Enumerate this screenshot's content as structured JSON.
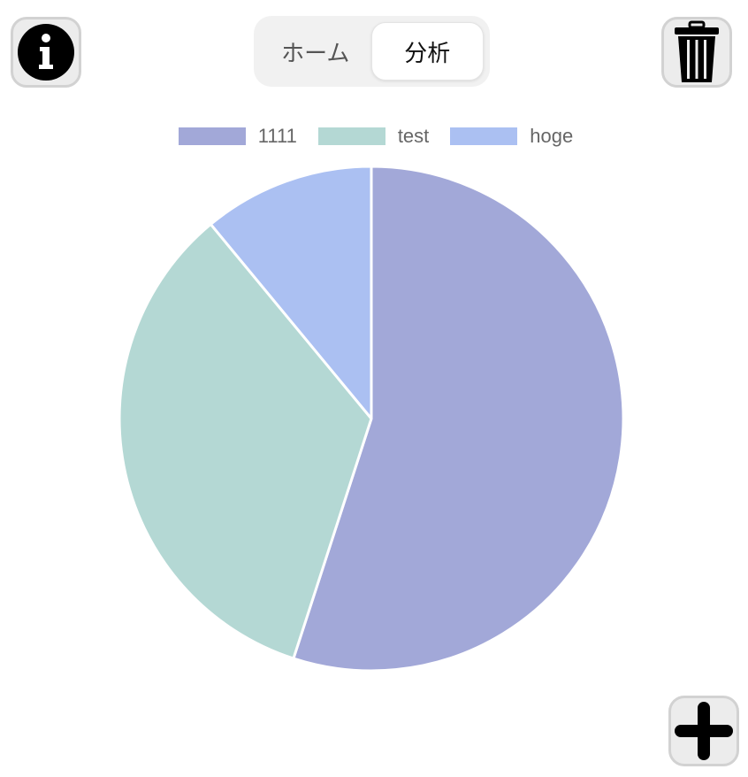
{
  "toolbar": {
    "info_icon": "info-icon",
    "trash_icon": "trash-icon",
    "add_icon": "plus-icon"
  },
  "tabs": [
    {
      "label": "ホーム",
      "active": false
    },
    {
      "label": "分析",
      "active": true
    }
  ],
  "chart_data": {
    "type": "pie",
    "categories": [
      "1111",
      "test",
      "hoge"
    ],
    "values": [
      55,
      34,
      11
    ],
    "colors": [
      "#a2a8d8",
      "#b4d8d4",
      "#abc0f2"
    ],
    "legend_position": "top",
    "start_angle": "12 o'clock",
    "direction": "clockwise"
  }
}
